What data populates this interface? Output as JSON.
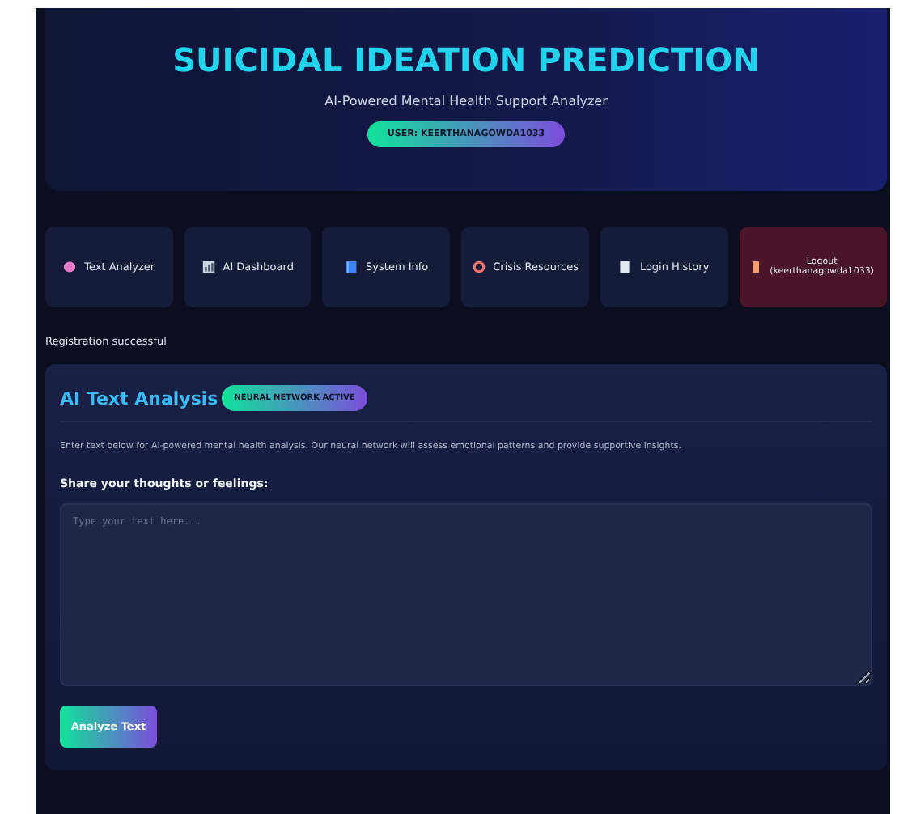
{
  "header": {
    "title": "SUICIDAL IDEATION PREDICTION",
    "subtitle": "AI-Powered Mental Health Support Analyzer",
    "user_badge": "USER: KEERTHANAGOWDA1033"
  },
  "nav": [
    {
      "label": "Text Analyzer",
      "kind": "nav"
    },
    {
      "label": "AI Dashboard",
      "kind": "nav"
    },
    {
      "label": "System Info",
      "kind": "nav"
    },
    {
      "label": "Crisis Resources",
      "kind": "nav"
    },
    {
      "label": "Login History",
      "kind": "nav"
    },
    {
      "label": "Logout (keerthanagowda1033)",
      "kind": "logout"
    }
  ],
  "flash": "Registration successful",
  "panel": {
    "title": "AI Text Analysis",
    "badge": "NEURAL NETWORK ACTIVE",
    "description": "Enter text below for AI-powered mental health analysis. Our neural network will assess emotional patterns and provide supportive insights.",
    "field_label": "Share your thoughts or feelings:",
    "placeholder": "Type your text here...",
    "button": "Analyze Text"
  }
}
